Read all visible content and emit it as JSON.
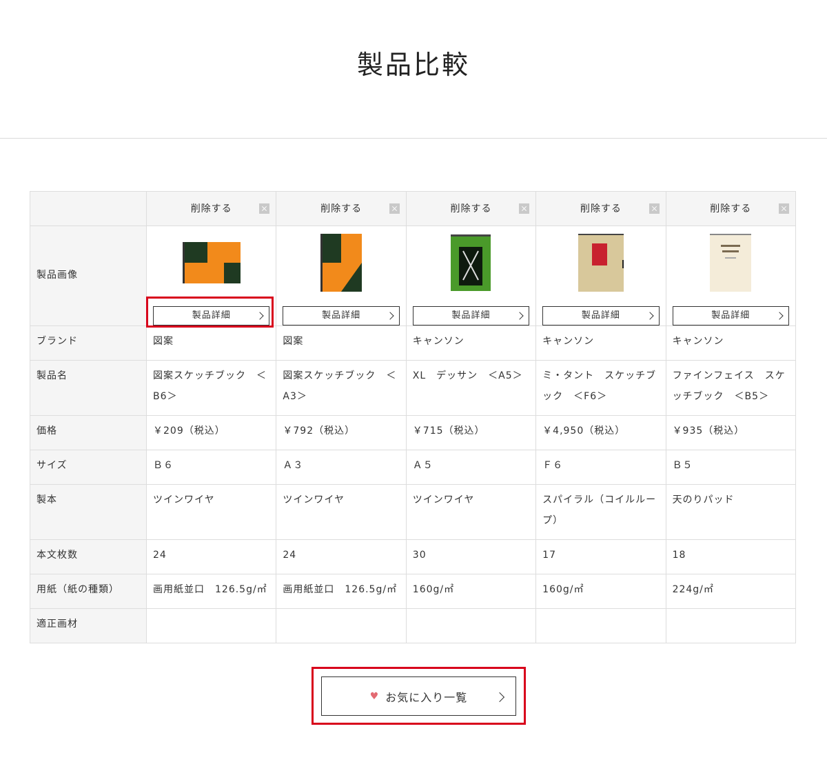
{
  "page_title": "製品比較",
  "remove_label": "削除する",
  "detail_label": "製品詳細",
  "favorites_label": "お気に入り一覧",
  "row_labels": {
    "image": "製品画像",
    "brand": "ブランド",
    "name": "製品名",
    "price": "価格",
    "size": "サイズ",
    "binding": "製本",
    "sheets": "本文枚数",
    "paper": "用紙（紙の種類）",
    "media": "適正画材"
  },
  "products": [
    {
      "brand": "図案",
      "name": "図案スケッチブック　＜B6＞",
      "price": "￥209（税込）",
      "size": "Ｂ６",
      "binding": "ツインワイヤ",
      "sheets": "24",
      "paper": "画用紙並口　126.5g/㎡",
      "media": "",
      "image_icon": "sketchbook-b6-icon"
    },
    {
      "brand": "図案",
      "name": "図案スケッチブック　＜A3＞",
      "price": "￥792（税込）",
      "size": "Ａ３",
      "binding": "ツインワイヤ",
      "sheets": "24",
      "paper": "画用紙並口　126.5g/㎡",
      "media": "",
      "image_icon": "sketchbook-a3-icon"
    },
    {
      "brand": "キャンソン",
      "name": "XL　デッサン　＜A5＞",
      "price": "￥715（税込）",
      "size": "Ａ５",
      "binding": "ツインワイヤ",
      "sheets": "30",
      "paper": "160g/㎡",
      "media": "",
      "image_icon": "canson-xl-icon"
    },
    {
      "brand": "キャンソン",
      "name": "ミ・タント　スケッチブック　＜F6＞",
      "price": "￥4,950（税込）",
      "size": "Ｆ６",
      "binding": "スパイラル（コイルループ）",
      "sheets": "17",
      "paper": "160g/㎡",
      "media": "",
      "image_icon": "mitientes-icon"
    },
    {
      "brand": "キャンソン",
      "name": "ファインフェイス　スケッチブック　＜B5＞",
      "price": "￥935（税込）",
      "size": "Ｂ５",
      "binding": "天のりパッド",
      "sheets": "18",
      "paper": "224g/㎡",
      "media": "",
      "image_icon": "fine-face-icon"
    }
  ],
  "colors": {
    "highlight": "#d8001b",
    "heart": "#e36a72",
    "label_bg": "#f5f5f5",
    "border": "#dddddd"
  }
}
